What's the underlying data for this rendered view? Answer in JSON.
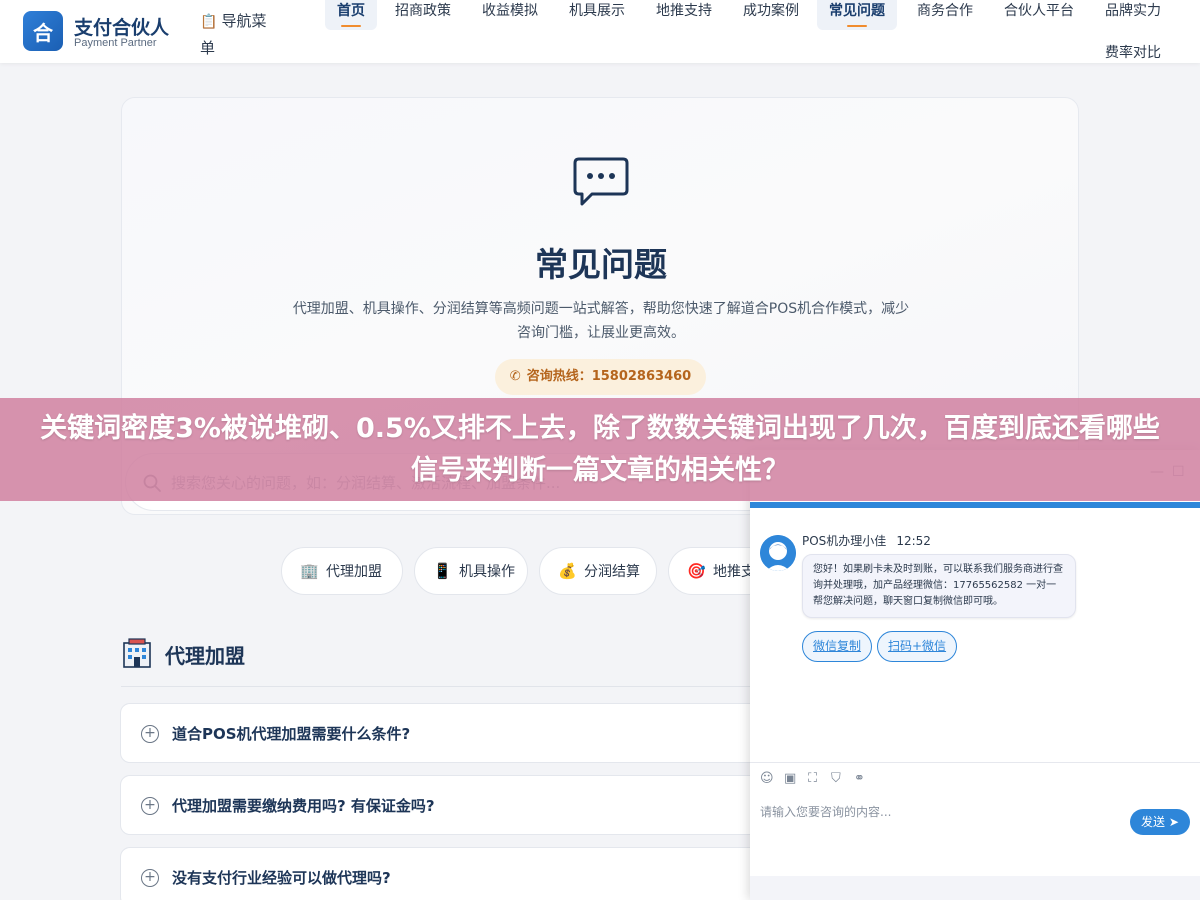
{
  "header": {
    "logo_mark": "合",
    "logo_title": "支付合伙人",
    "logo_subtitle": "Payment Partner",
    "menu_label": "导航菜单",
    "nav": [
      {
        "label": "首页",
        "active": true
      },
      {
        "label": "招商政策",
        "active": false
      },
      {
        "label": "收益模拟",
        "active": false
      },
      {
        "label": "机具展示",
        "active": false
      },
      {
        "label": "地推支持",
        "active": false
      },
      {
        "label": "成功案例",
        "active": false
      },
      {
        "label": "常见问题",
        "active": true
      },
      {
        "label": "商务合作",
        "active": false
      },
      {
        "label": "合伙人平台",
        "active": false
      },
      {
        "label": "品牌实力",
        "active": false
      },
      {
        "label": "费率对比",
        "active": false
      }
    ]
  },
  "hero": {
    "icon": "chat-bubble-icon",
    "title": "常见问题",
    "description": "代理加盟、机具操作、分润结算等高频问题一站式解答，帮助您快速了解道合POS机合作模式，减少咨询门槛，让展业更高效。",
    "hotline_label": "咨询热线：15802863460",
    "search_placeholder": "搜索您关心的问题，如：分润结算、激活流程、加盟条件..."
  },
  "categories": [
    {
      "label": "代理加盟",
      "icon": "office-building-icon"
    },
    {
      "label": "机具操作",
      "icon": "mobile-phone-icon"
    },
    {
      "label": "分润结算",
      "icon": "money-bag-icon"
    },
    {
      "label": "地推支",
      "icon": "target-icon"
    }
  ],
  "section": {
    "title": "代理加盟",
    "icon": "office-building-icon",
    "questions": [
      "道合POS机代理加盟需要什么条件?",
      "代理加盟需要缴纳费用吗? 有保证金吗?",
      "没有支付行业经验可以做代理吗?"
    ]
  },
  "banner": {
    "text": "关键词密度3%被说堆砌、0.5%又排不上去，除了数数关键词出现了几次，百度到底还看哪些信号来判断一篇文章的相关性？"
  },
  "chat": {
    "minimize": "—",
    "maximize": "☐",
    "agent_name": "POS机办理小佳",
    "time": "12:52",
    "message": "您好！如果刷卡未及时到账，可以联系我们服务商进行查询并处理哦，加产品经理微信：17765562582 一对一帮您解决问题，聊天窗口复制微信即可哦。",
    "quick_buttons": [
      "微信复制",
      "扫码+微信"
    ],
    "input_placeholder": "请输入您要咨询的内容...",
    "send_label": "发送",
    "toolbar_icons": [
      "emoji-icon",
      "image-icon",
      "screenshot-icon",
      "shield-icon",
      "wechat-icon"
    ],
    "colors": {
      "accent": "#2e86d9"
    }
  }
}
